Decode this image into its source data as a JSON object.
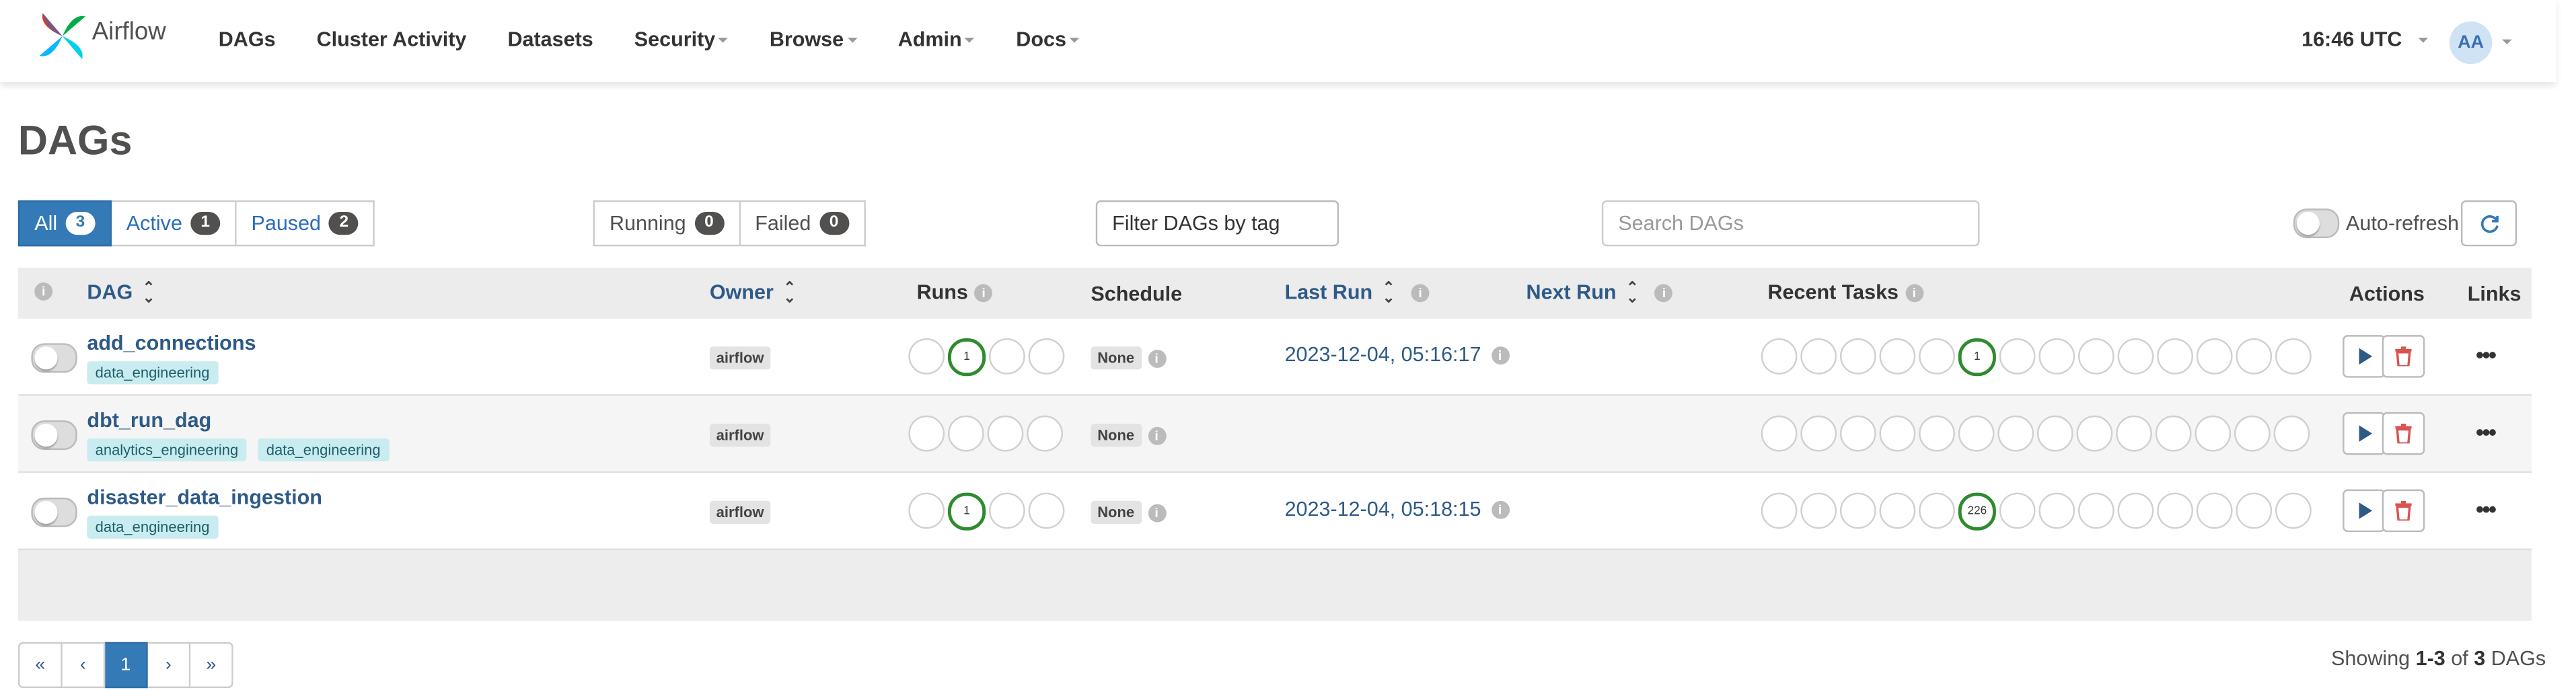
{
  "navbar": {
    "brand": "Airflow",
    "links": [
      {
        "label": "DAGs",
        "dropdown": false
      },
      {
        "label": "Cluster Activity",
        "dropdown": false
      },
      {
        "label": "Datasets",
        "dropdown": false
      },
      {
        "label": "Security",
        "dropdown": true
      },
      {
        "label": "Browse",
        "dropdown": true
      },
      {
        "label": "Admin",
        "dropdown": true
      },
      {
        "label": "Docs",
        "dropdown": true
      }
    ],
    "time": "16:46 UTC",
    "user_initials": "AA"
  },
  "page_title": "DAGs",
  "status_filters": [
    {
      "label": "All",
      "count": "3",
      "active": true
    },
    {
      "label": "Active",
      "count": "1",
      "active": false
    },
    {
      "label": "Paused",
      "count": "2",
      "active": false
    }
  ],
  "run_filters": [
    {
      "label": "Running",
      "count": "0"
    },
    {
      "label": "Failed",
      "count": "0"
    }
  ],
  "tag_filter": {
    "text": "Filter DAGs by tag"
  },
  "search": {
    "placeholder": "Search DAGs"
  },
  "auto_refresh": {
    "label": "Auto-refresh",
    "enabled": false
  },
  "table": {
    "headers": {
      "dag": "DAG",
      "owner": "Owner",
      "runs": "Runs",
      "schedule": "Schedule",
      "last_run": "Last Run",
      "next_run": "Next Run",
      "recent_tasks": "Recent Tasks",
      "actions": "Actions",
      "links": "Links"
    },
    "rows": [
      {
        "name": "add_connections",
        "tags": [
          "data_engineering"
        ],
        "owner": "airflow",
        "runs": [
          "",
          "1",
          "",
          ""
        ],
        "schedule": "None",
        "last_run": "2023-12-04, 05:16:17",
        "recent_tasks": [
          "",
          "",
          "",
          "",
          "",
          "1",
          "",
          "",
          "",
          "",
          "",
          "",
          "",
          ""
        ]
      },
      {
        "name": "dbt_run_dag",
        "tags": [
          "analytics_engineering",
          "data_engineering"
        ],
        "owner": "airflow",
        "runs": [
          "",
          "",
          "",
          ""
        ],
        "schedule": "None",
        "last_run": "",
        "recent_tasks": [
          "",
          "",
          "",
          "",
          "",
          "",
          "",
          "",
          "",
          "",
          "",
          "",
          "",
          ""
        ]
      },
      {
        "name": "disaster_data_ingestion",
        "tags": [
          "data_engineering"
        ],
        "owner": "airflow",
        "runs": [
          "",
          "1",
          "",
          ""
        ],
        "schedule": "None",
        "last_run": "2023-12-04, 05:18:15",
        "recent_tasks": [
          "",
          "",
          "",
          "",
          "",
          "226",
          "",
          "",
          "",
          "",
          "",
          "",
          "",
          ""
        ]
      }
    ]
  },
  "pagination": {
    "buttons": [
      "«",
      "‹",
      "1",
      "›",
      "»"
    ],
    "current": "1"
  },
  "showing": {
    "prefix": "Showing ",
    "range": "1-3",
    "middle": " of ",
    "total": "3",
    "suffix": " DAGs"
  },
  "colors": {
    "accent": "#337ab7",
    "success": "#2e8b2e",
    "danger": "#d9534f",
    "link": "#2e5a88"
  }
}
